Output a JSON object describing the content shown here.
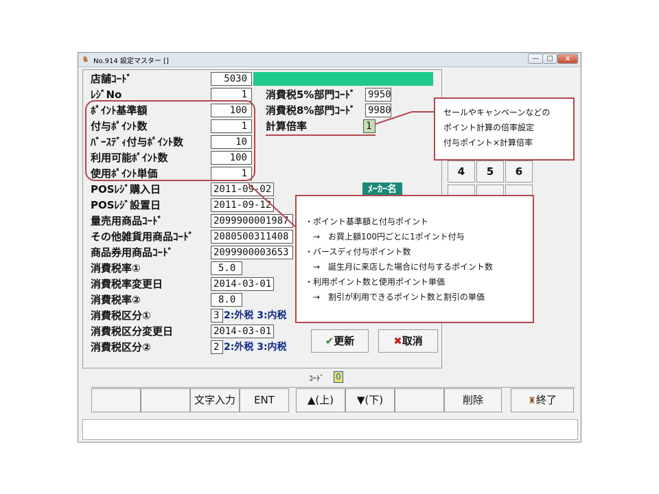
{
  "window": {
    "title": "No.914 設定マスター []",
    "minimize_label": "—",
    "maximize_label": "□",
    "close_label": "x"
  },
  "fields": {
    "store_code": {
      "label": "店舗ｺｰﾄﾞ",
      "value": "5030"
    },
    "register_no": {
      "label": "ﾚｼﾞNo",
      "value": "1"
    },
    "point_base": {
      "label": "ﾎﾟｲﾝﾄ基準額",
      "value": "100"
    },
    "grant_points": {
      "label": "付与ﾎﾟｲﾝﾄ数",
      "value": "1"
    },
    "birthday_points": {
      "label": "ﾊﾞｰｽﾃﾞｨ付与ﾎﾟｲﾝﾄ数",
      "value": "10"
    },
    "usable_points": {
      "label": "利用可能ﾎﾟｲﾝﾄ数",
      "value": "100"
    },
    "point_unit_price": {
      "label": "使用ﾎﾟｲﾝﾄ単価",
      "value": "1"
    },
    "pos_purchase_date": {
      "label": "POSﾚｼﾞ購入日",
      "value": "2011-09-02"
    },
    "pos_install_date": {
      "label": "POSﾚｼﾞ設置日",
      "value": "2011-09-12"
    },
    "bulk_product_code": {
      "label": "量売用商品ｺｰﾄﾞ",
      "value": "2099900001987"
    },
    "misc_product_code": {
      "label": "その他雑貨用商品ｺｰﾄﾞ",
      "value": "2080500311408"
    },
    "voucher_product_code": {
      "label": "商品券用商品ｺｰﾄﾞ",
      "value": "2099900003653"
    },
    "tax_rate_1": {
      "label": "消費税率①",
      "value": "5.0"
    },
    "tax_rate_change_date": {
      "label": "消費税率変更日",
      "value": "2014-03-01"
    },
    "tax_rate_2": {
      "label": "消費税率②",
      "value": "8.0"
    },
    "tax_class_1": {
      "label": "消費税区分①",
      "value": "3",
      "hint": "2:外税 3:内税"
    },
    "tax_class_change_date": {
      "label": "消費税区分変更日",
      "value": "2014-03-01"
    },
    "tax_class_2": {
      "label": "消費税区分②",
      "value": "2",
      "hint": "2:外税 3:内税"
    },
    "dept_5pct": {
      "label": "消費税5%部門ｺｰﾄﾞ",
      "value": "9950"
    },
    "dept_8pct": {
      "label": "消費税8%部門ｺｰﾄﾞ",
      "value": "9980"
    },
    "calc_multiplier": {
      "label": "計算倍率",
      "value": "1"
    }
  },
  "maker_label": "ﾒｰｶｰ名",
  "keypad": [
    "4",
    "5",
    "6"
  ],
  "buttons": {
    "update": "更新",
    "cancel": "取消"
  },
  "code_indicator": {
    "label": "ｺｰﾄﾞ",
    "value": "0"
  },
  "function_keys": [
    "",
    "",
    "文字入力",
    "ENT",
    "▲(上)",
    "▼(下)",
    "",
    "削除",
    "終了"
  ],
  "callouts": {
    "multiplier": [
      "セールやキャンペーンなどの",
      "ポイント計算の倍率設定",
      "付与ポイント×計算倍率"
    ],
    "points": [
      "・ポイント基準額と付与ポイント",
      "　→　お買上額100円ごとに1ポイント付与",
      "・バースディ付与ポイント数",
      "　→　誕生月に来店した場合に付与するポイント数",
      "・利用ポイント数と使用ポイント単価",
      "　→　割引が利用できるポイント数と割引の単価"
    ]
  },
  "colors": {
    "accent_bar": "#1ec98a",
    "multiplier_field": "#c6e0b8",
    "maker_badge": "#1a8a78",
    "callout_border": "#b0484e",
    "check_icon": "#2f7d2f",
    "cross_icon": "#c02020"
  }
}
